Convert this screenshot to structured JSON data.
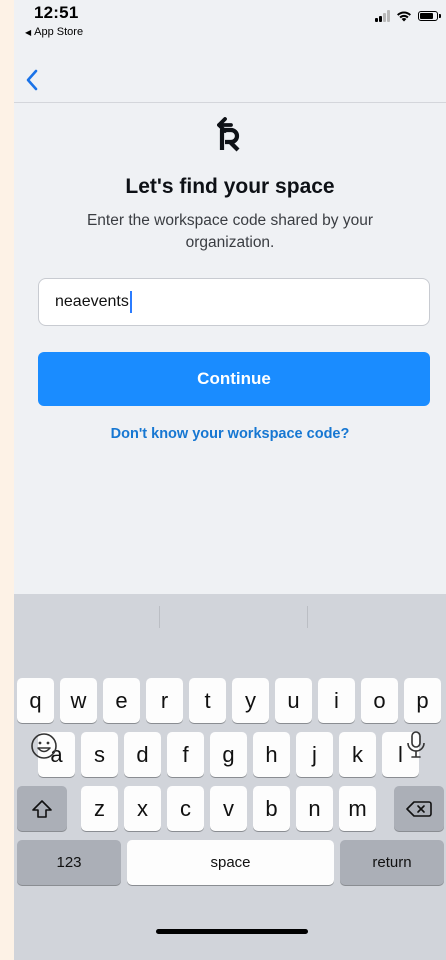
{
  "status_bar": {
    "time": "12:51",
    "back_app": "App Store"
  },
  "nav": {
    "back_icon": "chevron-left"
  },
  "logo_icon": "r-logo",
  "title": "Let's find your space",
  "subtitle": "Enter the workspace code shared by your organization.",
  "workspace_input": {
    "value": "neaevents"
  },
  "continue_label": "Continue",
  "help_link": "Don't know your workspace code?",
  "keyboard": {
    "row1": [
      "q",
      "w",
      "e",
      "r",
      "t",
      "y",
      "u",
      "i",
      "o",
      "p"
    ],
    "row2": [
      "a",
      "s",
      "d",
      "f",
      "g",
      "h",
      "j",
      "k",
      "l"
    ],
    "row3": [
      "z",
      "x",
      "c",
      "v",
      "b",
      "n",
      "m"
    ],
    "numbers_label": "123",
    "space_label": "space",
    "return_label": "return"
  },
  "colors": {
    "accent": "#1a8cff",
    "link": "#1677d2",
    "background": "#eff1f4",
    "keyboard_bg": "#d1d4da"
  }
}
